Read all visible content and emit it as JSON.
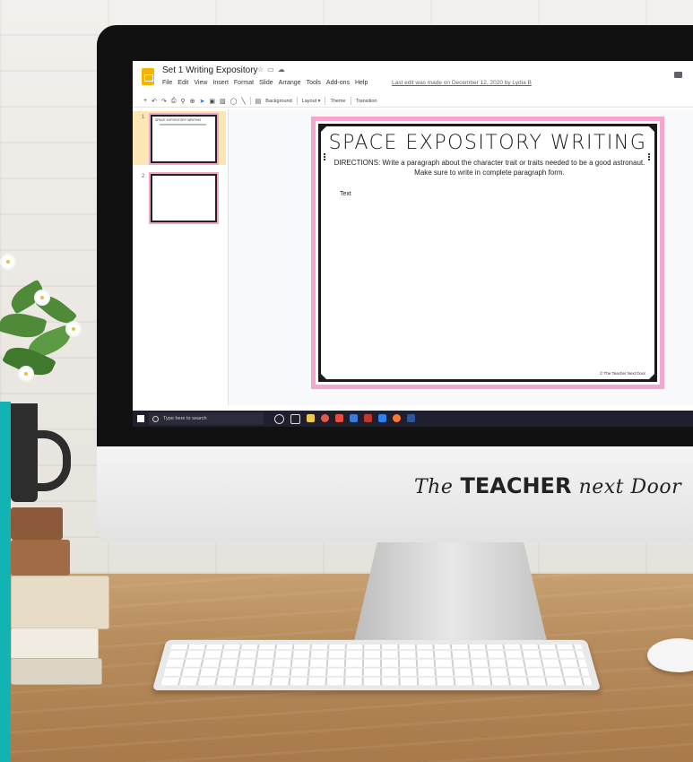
{
  "app": {
    "doc_title": "Set 1 Writing Expository",
    "menu": [
      "File",
      "Edit",
      "View",
      "Insert",
      "Format",
      "Slide",
      "Arrange",
      "Tools",
      "Add-ons",
      "Help"
    ],
    "last_edit": "Last edit was made on December 12, 2020 by Lydia B"
  },
  "toolbar": {
    "background": "Background",
    "layout": "Layout ▾",
    "theme": "Theme",
    "transition": "Transition"
  },
  "filmstrip": {
    "slides": [
      {
        "num": "1",
        "title": "SPACE EXPOSITORY WRITING"
      },
      {
        "num": "2",
        "title": ""
      }
    ]
  },
  "slide": {
    "title": "SPACE EXPOSITORY WRITING",
    "directions": "DIRECTIONS: Write a paragraph about the character trait or traits needed to be a good astronaut. Make sure to write in complete paragraph form.",
    "body": "Text",
    "copyright": "© The Teacher Next Door"
  },
  "taskbar": {
    "search_placeholder": "Type here to search"
  },
  "brand": {
    "the": "The",
    "teacher": "TEACHER",
    "next_door": "next Door"
  },
  "colors": {
    "slides_yellow": "#f4b400",
    "slide_border_pink": "#f4a6cf",
    "active_thumb": "#fbe7b5",
    "teal_accent": "#12b3b3",
    "taskbar": "#1f1f2e"
  }
}
